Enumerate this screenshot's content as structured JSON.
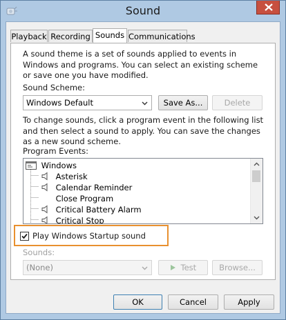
{
  "window": {
    "title": "Sound"
  },
  "tabs": [
    {
      "label": "Playback"
    },
    {
      "label": "Recording"
    },
    {
      "label": "Sounds",
      "active": true
    },
    {
      "label": "Communications"
    }
  ],
  "sounds_tab": {
    "description": "A sound theme is a set of sounds applied to events in Windows and programs.  You can select an existing scheme or save one you have modified.",
    "scheme_label": "Sound Scheme:",
    "scheme_value": "Windows Default",
    "save_as_label": "Save As...",
    "delete_label": "Delete",
    "instructions": "To change sounds, click a program event in the following list and then select a sound to apply.  You can save the changes as a new sound scheme.",
    "program_events_label": "Program Events:",
    "events": {
      "root": "Windows",
      "items": [
        {
          "label": "Asterisk",
          "has_sound": true
        },
        {
          "label": "Calendar Reminder",
          "has_sound": true
        },
        {
          "label": "Close Program",
          "has_sound": false
        },
        {
          "label": "Critical Battery Alarm",
          "has_sound": true
        },
        {
          "label": "Critical Stop",
          "has_sound": true
        }
      ]
    },
    "startup_checkbox_label": "Play Windows Startup sound",
    "startup_checked": true,
    "sounds_label": "Sounds:",
    "sounds_value": "(None)",
    "test_label": "Test",
    "browse_label": "Browse..."
  },
  "footer": {
    "ok_label": "OK",
    "cancel_label": "Cancel",
    "apply_label": "Apply"
  },
  "colors": {
    "highlight_border": "#e8902f",
    "title_bar": "#afc9e3",
    "close_button": "#c7503f"
  }
}
